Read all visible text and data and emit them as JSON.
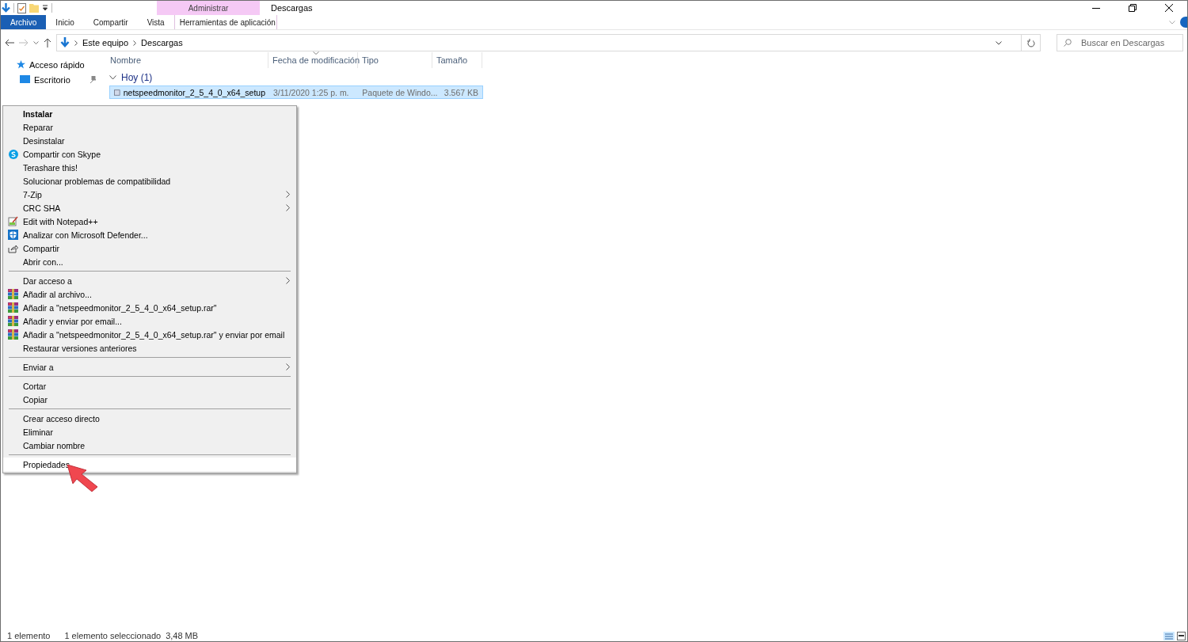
{
  "window": {
    "title": "Descargas",
    "context_group": "Administrar"
  },
  "ribbon_tabs": [
    {
      "label": "Archivo",
      "kind": "file"
    },
    {
      "label": "Inicio",
      "kind": "tab"
    },
    {
      "label": "Compartir",
      "kind": "tab"
    },
    {
      "label": "Vista",
      "kind": "tab"
    },
    {
      "label": "Herramientas de aplicación",
      "kind": "context"
    }
  ],
  "address": {
    "path": [
      "Este equipo",
      "Descargas"
    ]
  },
  "search": {
    "placeholder": "Buscar en Descargas"
  },
  "sidebar": {
    "items": [
      {
        "label": "Acceso rápido",
        "kind": "star",
        "pinned": false
      },
      {
        "label": "Escritorio",
        "kind": "desktop",
        "pinned": true
      }
    ]
  },
  "table": {
    "columns": [
      {
        "label": "Nombre",
        "sorted": false
      },
      {
        "label": "Fecha de modificación",
        "sorted": true
      },
      {
        "label": "Tipo",
        "sorted": false
      },
      {
        "label": "Tamaño",
        "sorted": false
      }
    ],
    "groups": [
      {
        "label": "Hoy (1)",
        "expanded": true,
        "rows": [
          {
            "selected": true,
            "cells": [
              "netspeedmonitor_2_5_4_0_x64_setup",
              "3/11/2020 1:25 p. m.",
              "Paquete de Windo...",
              "3.567 KB"
            ]
          }
        ]
      }
    ]
  },
  "context_menu": {
    "items": [
      {
        "kind": "plain",
        "label": "Instalar",
        "bold": true,
        "submenu": false,
        "hovered": false
      },
      {
        "kind": "plain",
        "label": "Reparar",
        "bold": false,
        "submenu": false,
        "hovered": false
      },
      {
        "kind": "plain",
        "label": "Desinstalar",
        "bold": false,
        "submenu": false,
        "hovered": false
      },
      {
        "kind": "skype",
        "label": "Compartir con Skype",
        "bold": false,
        "submenu": false,
        "hovered": false
      },
      {
        "kind": "plain",
        "label": "Terashare this!",
        "bold": false,
        "submenu": false,
        "hovered": false
      },
      {
        "kind": "plain",
        "label": "Solucionar problemas de compatibilidad",
        "bold": false,
        "submenu": false,
        "hovered": false
      },
      {
        "kind": "plain",
        "label": "7-Zip",
        "bold": false,
        "submenu": true,
        "hovered": false
      },
      {
        "kind": "plain",
        "label": "CRC SHA",
        "bold": false,
        "submenu": true,
        "hovered": false
      },
      {
        "kind": "notepad",
        "label": "Edit with Notepad++",
        "bold": false,
        "submenu": false,
        "hovered": false
      },
      {
        "kind": "shield",
        "label": "Analizar con Microsoft Defender...",
        "bold": false,
        "submenu": false,
        "hovered": false
      },
      {
        "kind": "share",
        "label": "Compartir",
        "bold": false,
        "submenu": false,
        "hovered": false
      },
      {
        "kind": "plain",
        "label": "Abrir con...",
        "bold": false,
        "submenu": false,
        "hovered": false
      },
      {
        "kind": "separator"
      },
      {
        "kind": "plain",
        "label": "Dar acceso a",
        "bold": false,
        "submenu": true,
        "hovered": false
      },
      {
        "kind": "archive",
        "label": "Añadir al archivo...",
        "bold": false,
        "submenu": false,
        "hovered": false
      },
      {
        "kind": "archive",
        "label": "Añadir a \"netspeedmonitor_2_5_4_0_x64_setup.rar\"",
        "bold": false,
        "submenu": false,
        "hovered": false
      },
      {
        "kind": "archive",
        "label": "Añadir y enviar por email...",
        "bold": false,
        "submenu": false,
        "hovered": false
      },
      {
        "kind": "archive",
        "label": "Añadir a \"netspeedmonitor_2_5_4_0_x64_setup.rar\" y enviar por email",
        "bold": false,
        "submenu": false,
        "hovered": false
      },
      {
        "kind": "plain",
        "label": "Restaurar versiones anteriores",
        "bold": false,
        "submenu": false,
        "hovered": false
      },
      {
        "kind": "separator"
      },
      {
        "kind": "plain",
        "label": "Enviar a",
        "bold": false,
        "submenu": true,
        "hovered": false
      },
      {
        "kind": "separator"
      },
      {
        "kind": "plain",
        "label": "Cortar",
        "bold": false,
        "submenu": false,
        "hovered": false
      },
      {
        "kind": "plain",
        "label": "Copiar",
        "bold": false,
        "submenu": false,
        "hovered": false
      },
      {
        "kind": "separator"
      },
      {
        "kind": "plain",
        "label": "Crear acceso directo",
        "bold": false,
        "submenu": false,
        "hovered": false
      },
      {
        "kind": "plain",
        "label": "Eliminar",
        "bold": false,
        "submenu": false,
        "hovered": false
      },
      {
        "kind": "plain",
        "label": "Cambiar nombre",
        "bold": false,
        "submenu": false,
        "hovered": false
      },
      {
        "kind": "separator"
      },
      {
        "kind": "plain",
        "label": "Propiedades",
        "bold": false,
        "submenu": false,
        "hovered": true
      }
    ]
  },
  "status_bar": [
    "1 elemento",
    "1 elemento seleccionado",
    "3,48 MB"
  ]
}
